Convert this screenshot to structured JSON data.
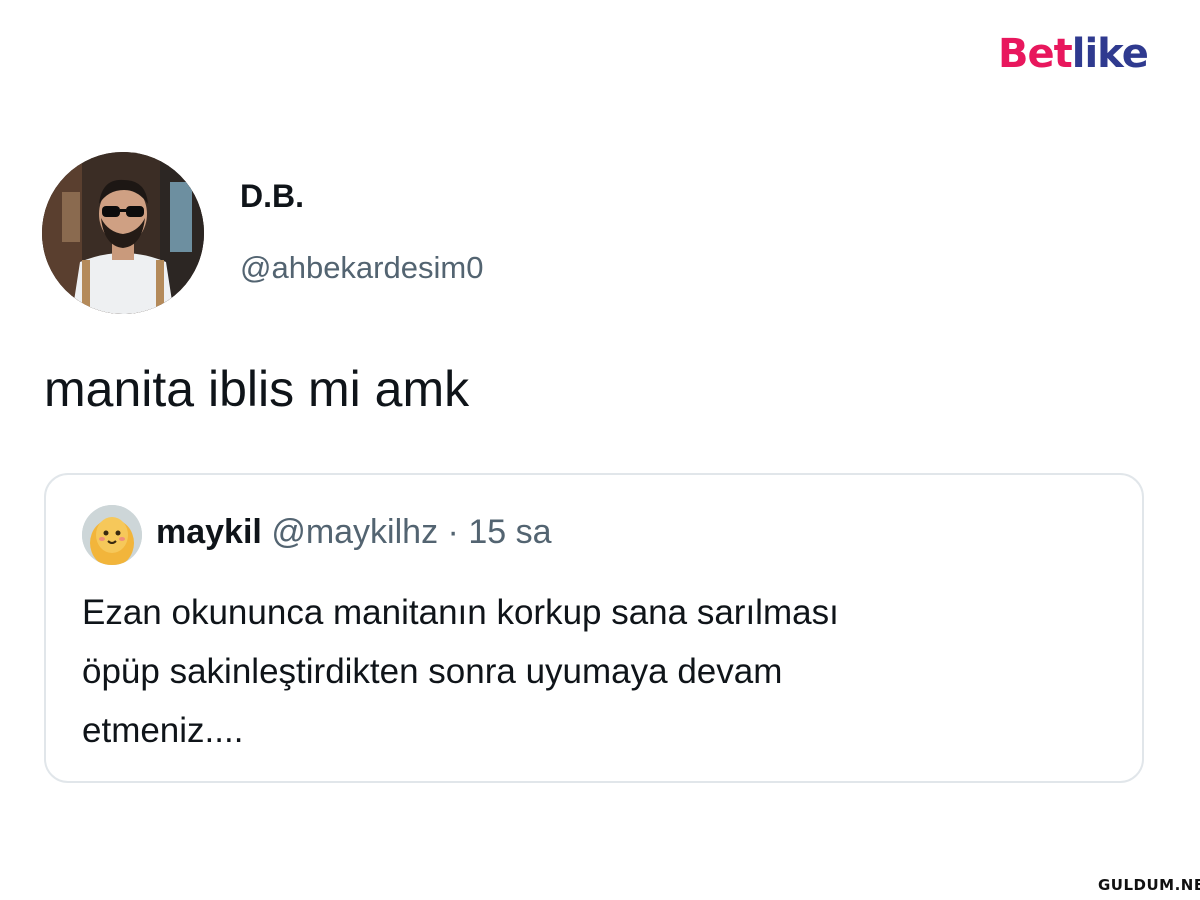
{
  "brand": {
    "part1": "Bet",
    "part2": "like",
    "accent_color": "#e8175d",
    "secondary_color": "#2f3a8f"
  },
  "tweet": {
    "author": {
      "display_name": "D.B.",
      "handle": "@ahbekardesim0",
      "avatar_icon": "profile-photo"
    },
    "text": "manita iblis mi amk",
    "quoted": {
      "author_name": "maykil",
      "author_handle": "@maykilhz",
      "separator": "·",
      "time": "15 sa",
      "avatar_icon": "cartoon-chick-avatar",
      "body_lines": [
        "Ezan okununca manitanın korkup sana sarılması",
        "öpüp sakinleştirdikten sonra uyumaya devam",
        "etmeniz...."
      ]
    }
  },
  "watermark": {
    "site": "GULDUM.NET"
  }
}
